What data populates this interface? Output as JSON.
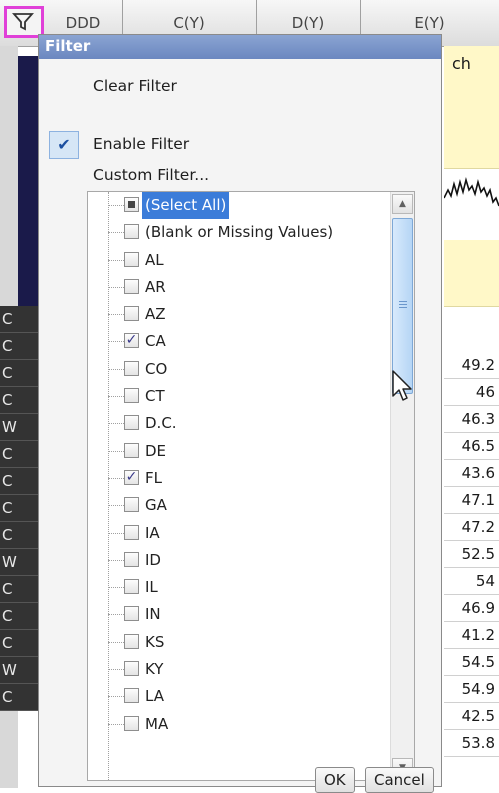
{
  "spreadsheet": {
    "columns": [
      "DDD",
      "C(Y)",
      "D(Y)",
      "E(Y)"
    ],
    "right_column_header": "ch",
    "name_column_values": [
      "C",
      "C",
      "C",
      "C",
      "W",
      "C",
      "C",
      "C",
      "C",
      "W",
      "C",
      "C",
      "C",
      "W",
      "C"
    ],
    "value_column_values": [
      "49.2",
      "46",
      "46.3",
      "46.5",
      "43.6",
      "47.1",
      "47.2",
      "52.5",
      "54",
      "46.9",
      "41.2",
      "54.5",
      "54.9",
      "42.5",
      "53.8"
    ]
  },
  "filter_popup": {
    "title": "Filter",
    "menu": {
      "clear_filter": "Clear Filter",
      "enable_filter": "Enable Filter",
      "custom_filter": "Custom Filter..."
    },
    "enable_filter_checked": true,
    "list_items": [
      {
        "label": "(Select All)",
        "state": "indeterminate",
        "selected": true
      },
      {
        "label": "(Blank or Missing Values)",
        "state": "unchecked"
      },
      {
        "label": "AL",
        "state": "unchecked"
      },
      {
        "label": "AR",
        "state": "unchecked"
      },
      {
        "label": "AZ",
        "state": "unchecked"
      },
      {
        "label": "CA",
        "state": "checked"
      },
      {
        "label": "CO",
        "state": "unchecked"
      },
      {
        "label": "CT",
        "state": "unchecked"
      },
      {
        "label": "D.C.",
        "state": "unchecked"
      },
      {
        "label": "DE",
        "state": "unchecked"
      },
      {
        "label": "FL",
        "state": "checked"
      },
      {
        "label": "GA",
        "state": "unchecked"
      },
      {
        "label": "IA",
        "state": "unchecked"
      },
      {
        "label": "ID",
        "state": "unchecked"
      },
      {
        "label": "IL",
        "state": "unchecked"
      },
      {
        "label": "IN",
        "state": "unchecked"
      },
      {
        "label": "KS",
        "state": "unchecked"
      },
      {
        "label": "KY",
        "state": "unchecked"
      },
      {
        "label": "LA",
        "state": "unchecked"
      },
      {
        "label": "MA",
        "state": "unchecked"
      }
    ],
    "buttons": {
      "ok": "OK",
      "cancel": "Cancel"
    }
  },
  "icons": {
    "filter_toggle": "funnel-icon",
    "check": "checkmark-icon",
    "cursor": "mouse-pointer-icon"
  },
  "colors": {
    "highlight_border": "#e040d8",
    "selection": "#3b7cd9",
    "titlebar": "#7a95c8"
  }
}
